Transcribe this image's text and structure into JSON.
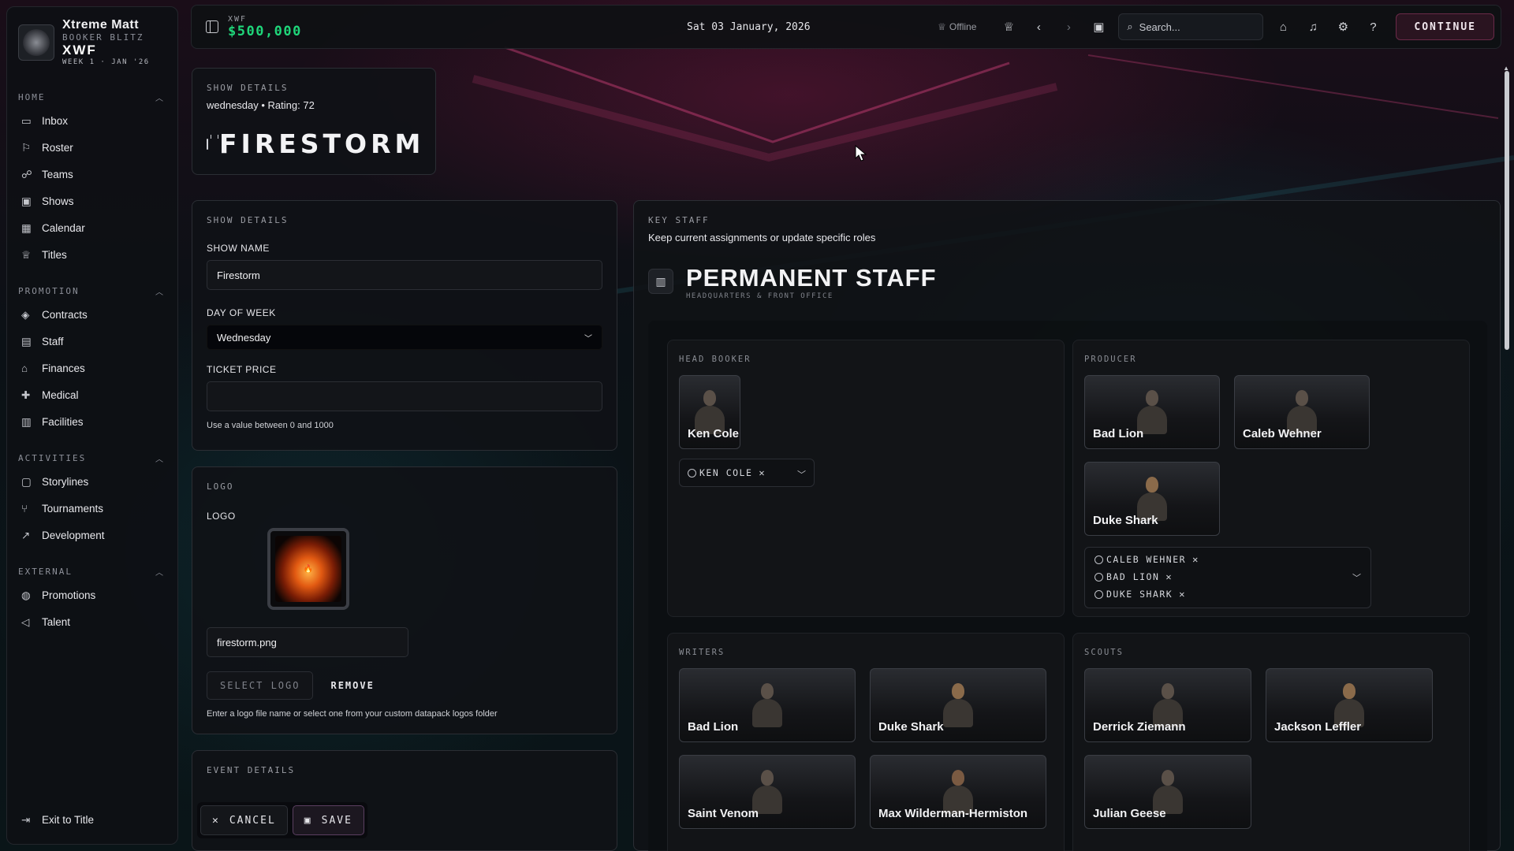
{
  "sidebar": {
    "player": "Xtreme Matt",
    "role": "BOOKER BLITZ",
    "promotion": "XWF",
    "week": "WEEK 1 · JAN '26",
    "sections": [
      {
        "title": "HOME",
        "items": [
          {
            "label": "Inbox",
            "icon": "inbox-icon"
          },
          {
            "label": "Roster",
            "icon": "roster-icon"
          },
          {
            "label": "Teams",
            "icon": "teams-icon"
          },
          {
            "label": "Shows",
            "icon": "shows-icon"
          },
          {
            "label": "Calendar",
            "icon": "calendar-icon"
          },
          {
            "label": "Titles",
            "icon": "trophy-icon"
          }
        ]
      },
      {
        "title": "PROMOTION",
        "items": [
          {
            "label": "Contracts",
            "icon": "contracts-icon"
          },
          {
            "label": "Staff",
            "icon": "staff-icon"
          },
          {
            "label": "Finances",
            "icon": "bank-icon"
          },
          {
            "label": "Medical",
            "icon": "medical-icon"
          },
          {
            "label": "Facilities",
            "icon": "building-icon"
          }
        ]
      },
      {
        "title": "ACTIVITIES",
        "items": [
          {
            "label": "Storylines",
            "icon": "storylines-icon"
          },
          {
            "label": "Tournaments",
            "icon": "bracket-icon"
          },
          {
            "label": "Development",
            "icon": "trend-icon"
          }
        ]
      },
      {
        "title": "EXTERNAL",
        "items": [
          {
            "label": "Promotions",
            "icon": "globe-icon"
          },
          {
            "label": "Talent",
            "icon": "megaphone-icon"
          }
        ]
      }
    ],
    "exit_label": "Exit to Title"
  },
  "topbar": {
    "code": "XWF",
    "money": "$500,000",
    "date": "Sat 03 January, 2026",
    "status": "Offline",
    "search_placeholder": "Search...",
    "continue_label": "CONTINUE"
  },
  "hero": {
    "section_label": "SHOW DETAILS",
    "subtitle": "wednesday • Rating: 72",
    "show_title": "FIRESTORM"
  },
  "details": {
    "section_label": "SHOW DETAILS",
    "name_label": "SHOW NAME",
    "name_value": "Firestorm",
    "day_label": "DAY OF WEEK",
    "day_value": "Wednesday",
    "price_label": "TICKET PRICE",
    "price_value": "",
    "price_hint": "Use a value between 0 and 1000"
  },
  "logo": {
    "section_label": "LOGO",
    "field_label": "LOGO",
    "file_value": "firestorm.png",
    "select_label": "SELECT LOGO",
    "remove_label": "REMOVE",
    "hint": "Enter a logo file name or select one from your custom datapack logos folder"
  },
  "event": {
    "section_label": "EVENT DETAILS"
  },
  "actions": {
    "cancel_label": "CANCEL",
    "save_label": "SAVE"
  },
  "staff": {
    "section_label": "KEY STAFF",
    "description": "Keep current assignments or update specific roles",
    "title": "PERMANENT STAFF",
    "subtitle": "HEADQUARTERS & FRONT OFFICE",
    "head_booker": {
      "label": "HEAD BOOKER",
      "people": [
        "Ken Cole"
      ],
      "chips": [
        "KEN COLE"
      ]
    },
    "producer": {
      "label": "PRODUCER",
      "people": [
        "Bad Lion",
        "Caleb Wehner",
        "Duke Shark"
      ],
      "chips": [
        "CALEB WEHNER",
        "BAD LION",
        "DUKE SHARK"
      ]
    },
    "writers": {
      "label": "WRITERS",
      "people": [
        "Bad Lion",
        "Duke Shark",
        "Saint Venom",
        "Max Wilderman-Hermiston"
      ]
    },
    "scouts": {
      "label": "SCOUTS",
      "people": [
        "Derrick Ziemann",
        "Jackson Leffler",
        "Julian Geese"
      ]
    }
  },
  "colors": {
    "accent_money": "#1fd67a",
    "continue_border": "#6a2a48"
  }
}
